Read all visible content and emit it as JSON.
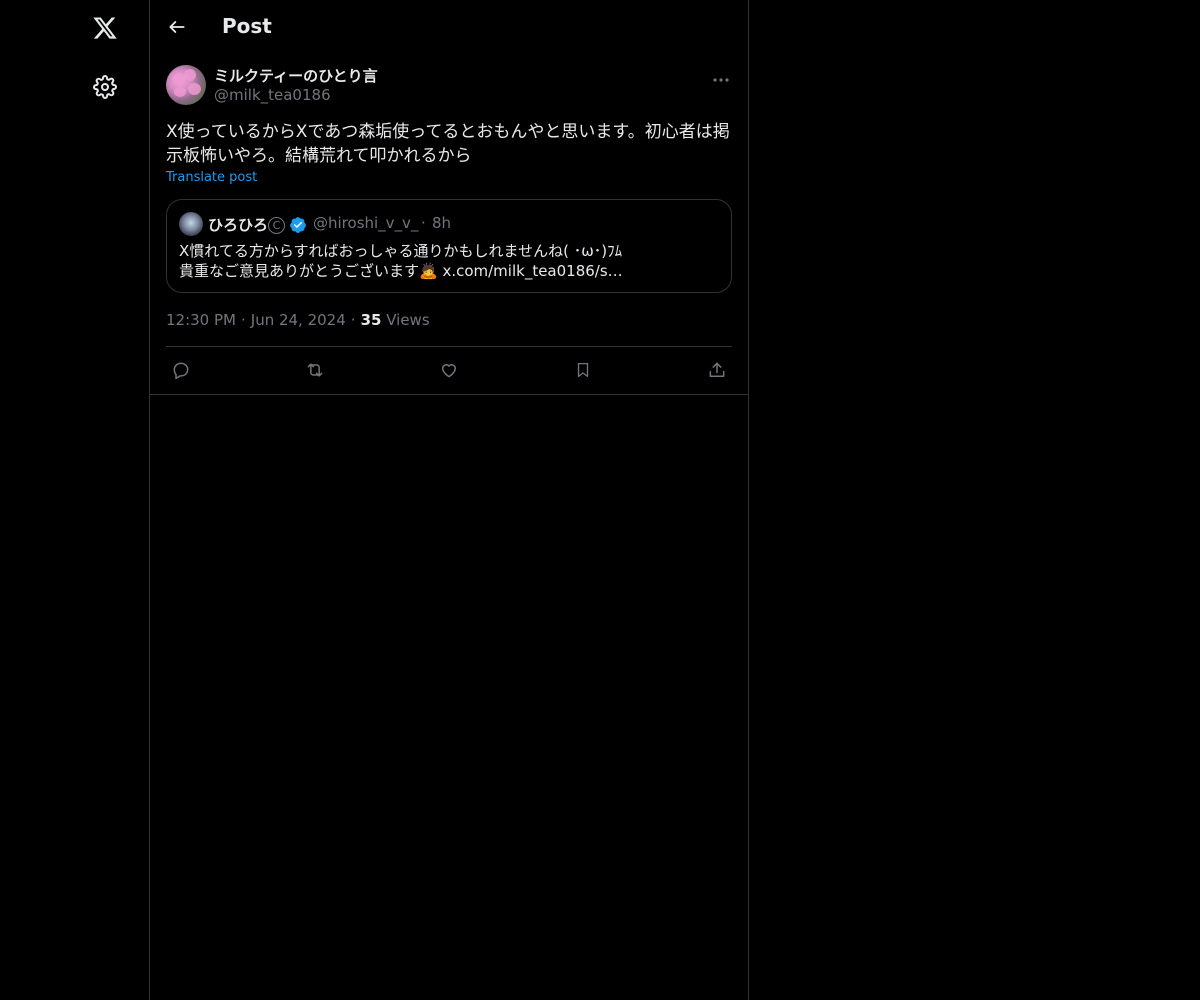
{
  "nav": {
    "logo_icon": "x-logo-icon",
    "settings_icon": "gear-icon"
  },
  "header": {
    "title": "Post",
    "back_icon": "arrow-left-icon"
  },
  "post": {
    "display_name": "ミルクティーのひとり言",
    "handle": "@milk_tea0186",
    "text": "X使っているからXであつ森垢使ってるとおもんやと思います。初心者は掲示板怖いやろ。結構荒れて叩かれるから",
    "translate_label": "Translate post",
    "time": "12:30 PM",
    "date": "Jun 24, 2024",
    "views_count": "35",
    "views_label": "Views"
  },
  "quote": {
    "display_name": "ひろひろ",
    "badge": "C",
    "handle": "@hiroshi_v_v_",
    "time": "8h",
    "line1": "X慣れてる方からすればおっしゃる通りかもしれませんね( ･ω･)ﾌﾑ",
    "line2": "貴重なご意見ありがとうございます🙇 x.com/milk_tea0186/s…"
  },
  "colors": {
    "background": "#000000",
    "border": "#2f3336",
    "text_primary": "#e7e9ea",
    "text_secondary": "#71767b",
    "accent": "#1d9bf0"
  }
}
